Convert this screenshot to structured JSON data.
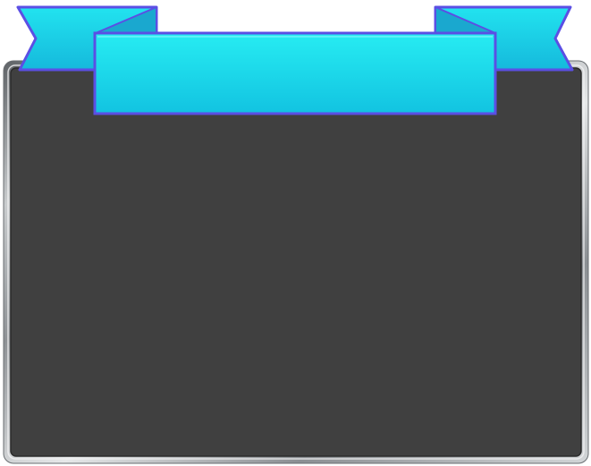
{
  "panel": {
    "title": "",
    "frame_color": "#9fa3a7",
    "board_color": "#404040"
  },
  "ribbon": {
    "label": "",
    "fill_top": "#27ecf2",
    "fill_bottom": "#12c3e1",
    "outline_color": "#5b4fe4"
  },
  "icons": {
    "ribbon": "ribbon-banner-icon"
  }
}
